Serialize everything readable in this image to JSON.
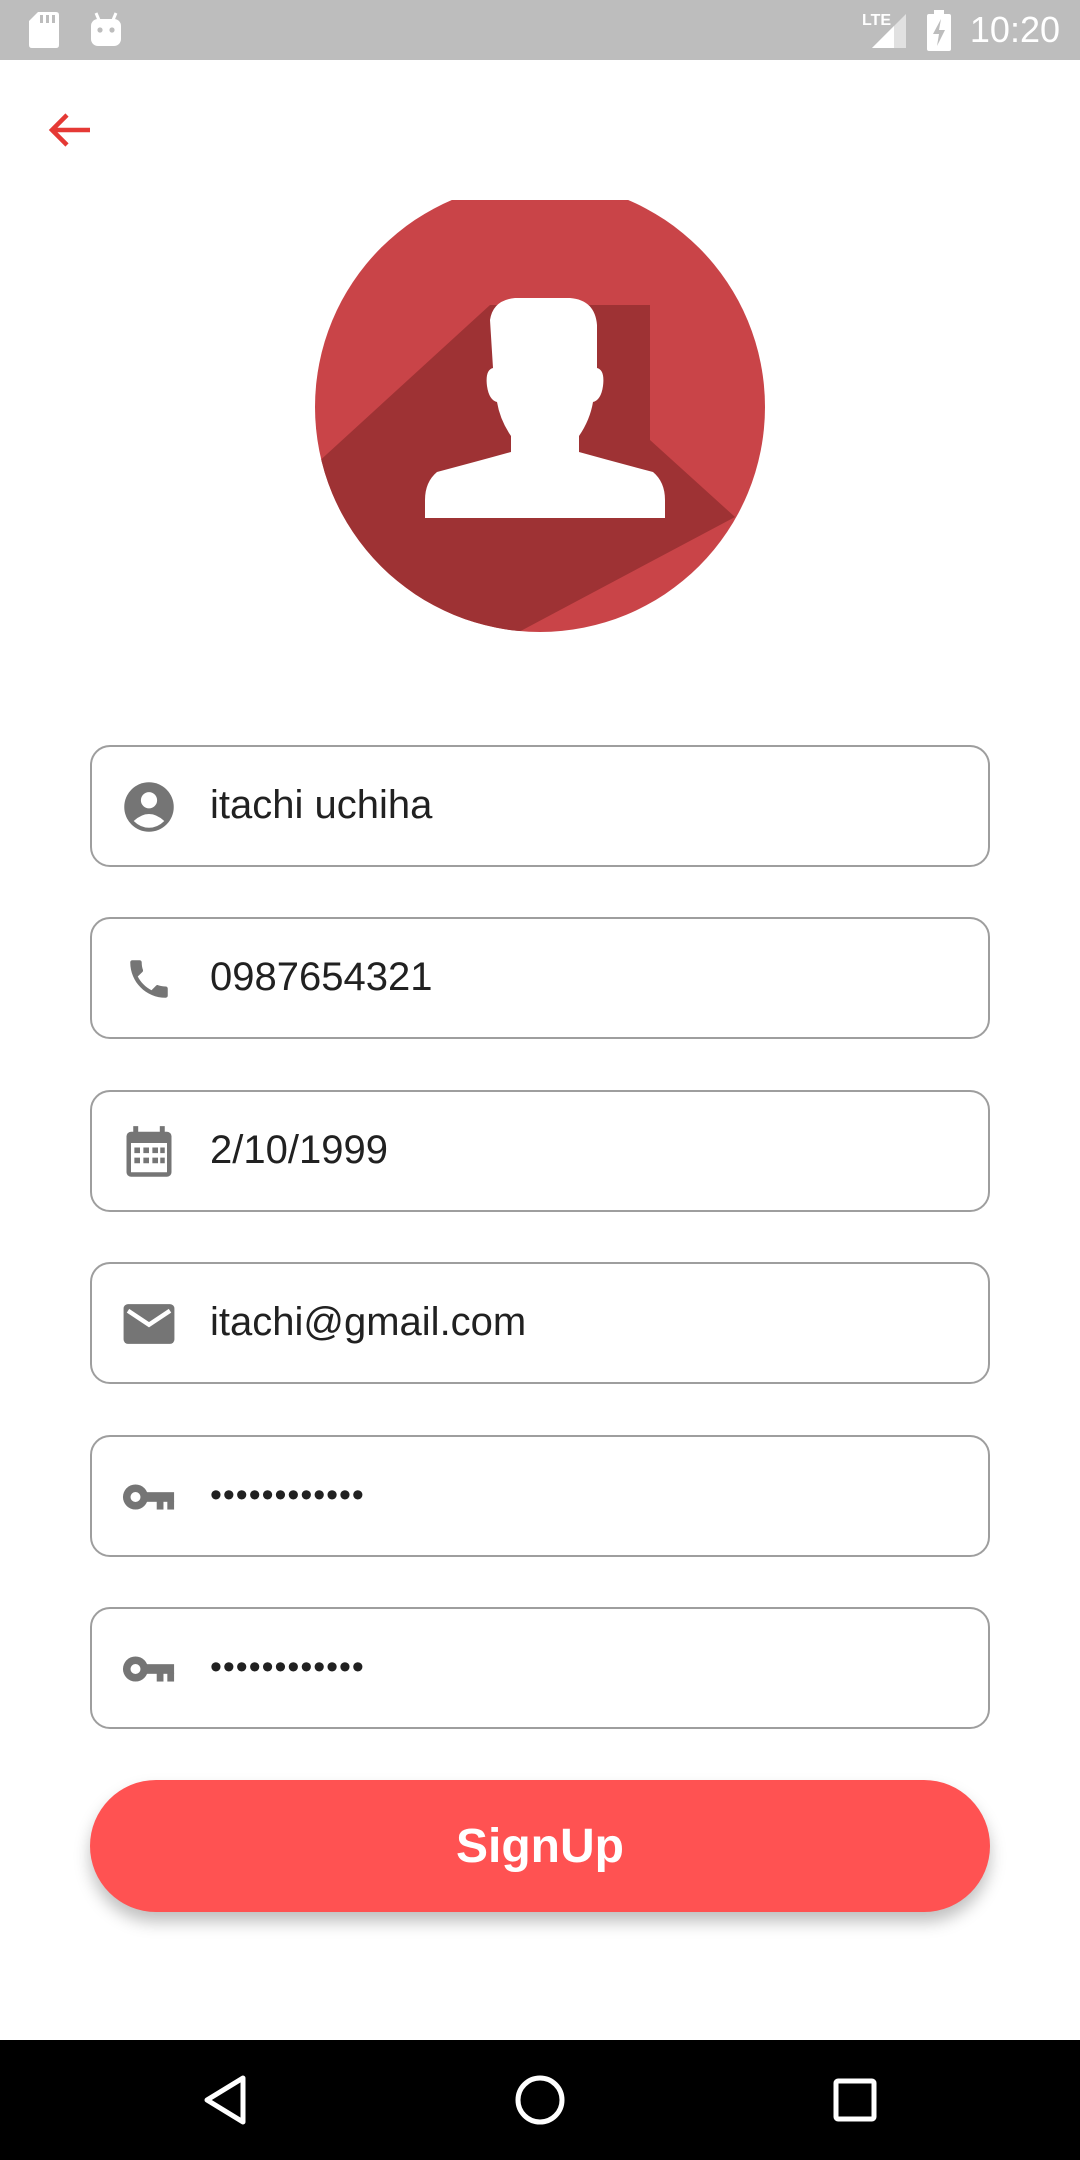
{
  "status_bar": {
    "time": "10:20",
    "network_label": "LTE",
    "icons": [
      "sd-card-icon",
      "android-icon",
      "lte-signal-icon",
      "battery-charging-icon"
    ]
  },
  "app_bar": {
    "back_icon": "arrow-back-icon"
  },
  "avatar": {
    "icon": "user-silhouette-icon"
  },
  "form": {
    "fields": [
      {
        "icon": "account-circle-icon",
        "value": "itachi uchiha"
      },
      {
        "icon": "phone-icon",
        "value": "0987654321"
      },
      {
        "icon": "calendar-icon",
        "value": "2/10/1999"
      },
      {
        "icon": "email-icon",
        "value": "itachi@gmail.com"
      },
      {
        "icon": "key-icon",
        "value": "••••••••••••"
      },
      {
        "icon": "key-icon",
        "value": "••••••••••••"
      }
    ],
    "submit_label": "SignUp"
  },
  "nav_bar": {
    "icons": [
      "back-triangle-icon",
      "home-circle-icon",
      "recents-square-icon"
    ]
  },
  "colors": {
    "accent": "#ff5252",
    "avatar": "#c94448",
    "avatar_shadow": "#9e3234",
    "back_arrow": "#e53935",
    "field_border": "#9e9e9e",
    "field_icon": "#757575",
    "status_bar": "#bdbdbd",
    "nav_bar": "#000000"
  }
}
